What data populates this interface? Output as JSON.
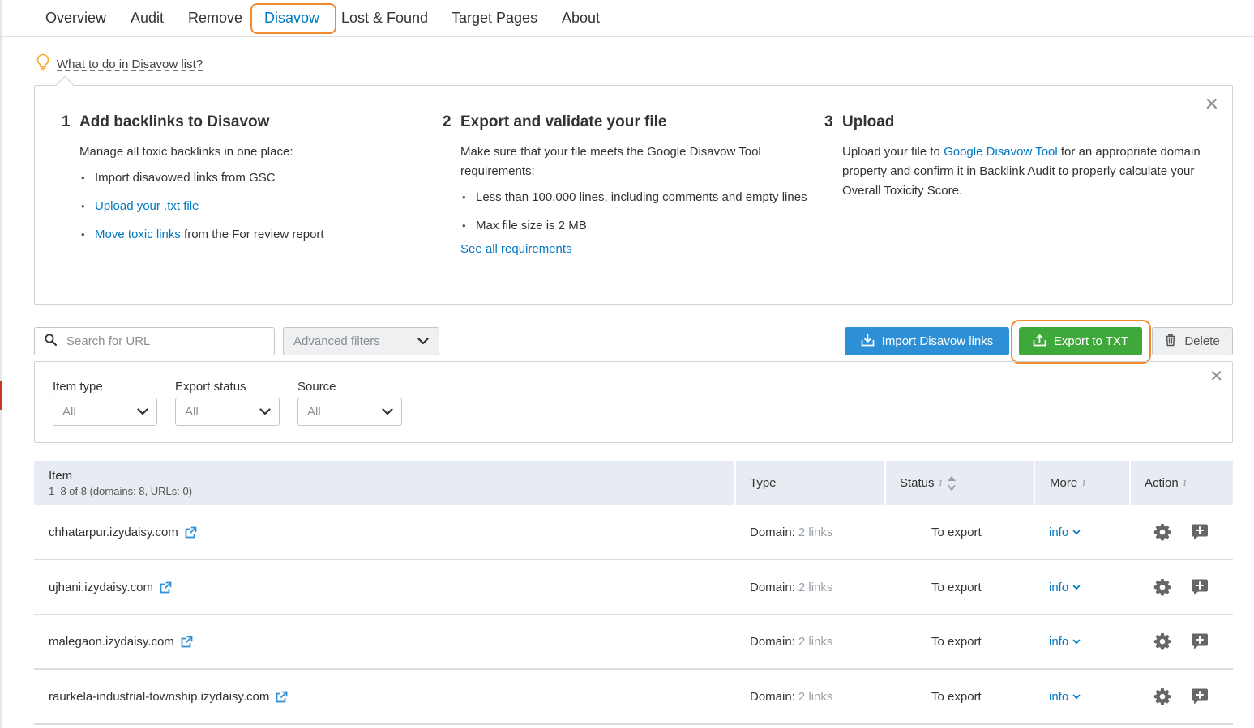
{
  "tabs": [
    {
      "label": "Overview"
    },
    {
      "label": "Audit"
    },
    {
      "label": "Remove"
    },
    {
      "label": "Disavow"
    },
    {
      "label": "Lost & Found"
    },
    {
      "label": "Target Pages"
    },
    {
      "label": "About"
    }
  ],
  "hint": {
    "label": "What to do in Disavow list?"
  },
  "steps": [
    {
      "num": "1",
      "title": "Add backlinks to Disavow",
      "intro": "Manage all toxic backlinks in one place:",
      "bullet1": "Import disavowed links from GSC",
      "bullet2_link": "Upload your .txt file",
      "bullet3_link": "Move toxic links",
      "bullet3_rest": "from the For review report"
    },
    {
      "num": "2",
      "title": "Export and validate your file",
      "intro": "Make sure that your file meets the Google Disavow Tool requirements:",
      "bullet1": "Less than 100,000 lines, including comments and empty lines",
      "bullet2": "Max file size is 2 MB",
      "link": "See all requirements"
    },
    {
      "num": "3",
      "title": "Upload",
      "text_before": "Upload your file to",
      "link": "Google Disavow Tool",
      "text_after": "for an appropriate domain property and confirm it in Backlink Audit to properly calculate your Overall Toxicity Score."
    }
  ],
  "toolbar": {
    "search_placeholder": "Search for URL",
    "advanced_filters": "Advanced filters",
    "import_label": "Import Disavow links",
    "export_label": "Export to TXT",
    "delete_label": "Delete"
  },
  "filters": {
    "item_type": {
      "label": "Item type",
      "value": "All"
    },
    "export_status": {
      "label": "Export status",
      "value": "All"
    },
    "source": {
      "label": "Source",
      "value": "All"
    }
  },
  "table": {
    "columns": {
      "item": "Item",
      "item_sub": "1–8 of 8 (domains: 8, URLs: 0)",
      "type": "Type",
      "status": "Status",
      "more": "More",
      "action": "Action"
    },
    "rows": [
      {
        "url": "chhatarpur.izydaisy.com",
        "type_prefix": "Domain:",
        "links": "2 links",
        "status": "To export",
        "more": "info"
      },
      {
        "url": "ujhani.izydaisy.com",
        "type_prefix": "Domain:",
        "links": "2 links",
        "status": "To export",
        "more": "info"
      },
      {
        "url": "malegaon.izydaisy.com",
        "type_prefix": "Domain:",
        "links": "2 links",
        "status": "To export",
        "more": "info"
      },
      {
        "url": "raurkela-industrial-township.izydaisy.com",
        "type_prefix": "Domain:",
        "links": "2 links",
        "status": "To export",
        "more": "info"
      }
    ]
  },
  "colors": {
    "accent_blue": "#0079c2",
    "import_button": "#2d8fd5",
    "export_button": "#3fa83a",
    "highlight_orange": "#f28a30"
  }
}
